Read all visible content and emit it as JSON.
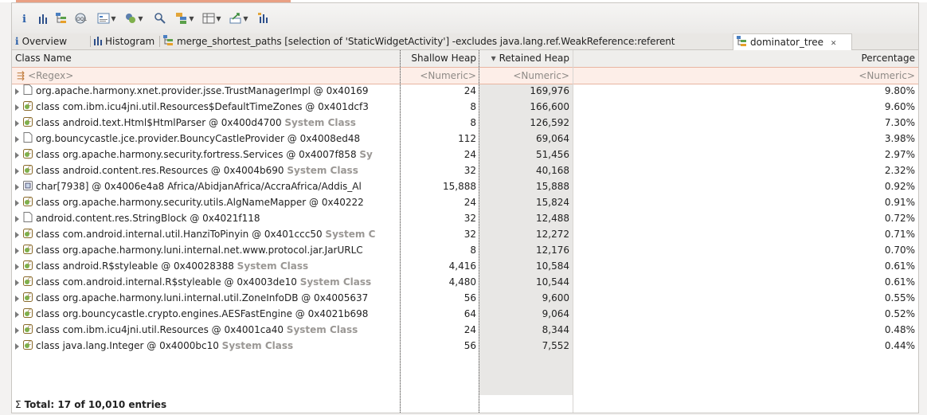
{
  "tabs": [
    {
      "icon": "info-icon",
      "label": "Overview",
      "active": false
    },
    {
      "icon": "histogram-icon",
      "label": "Histogram",
      "active": false
    },
    {
      "icon": "tree-icon",
      "label": "merge_shortest_paths [selection of 'StaticWidgetActivity'] -excludes java.lang.ref.WeakReference:referent",
      "active": false
    },
    {
      "icon": "tree-icon",
      "label": "dominator_tree",
      "active": true,
      "close": "✕"
    }
  ],
  "toolbar": {
    "buttons": [
      "info-icon",
      "histogram-icon",
      "dominator-tree-icon",
      "top-consumers-icon",
      "query-browser-icon",
      "group-icon",
      "search-icon",
      "grouping-icon",
      "calculate-retained-icon",
      "export-icon",
      "overview-icon"
    ]
  },
  "columns": {
    "class_name": "Class Name",
    "shallow_heap": "Shallow Heap",
    "retained_heap": "Retained Heap",
    "retained_sort": "▾",
    "percentage": "Percentage"
  },
  "filter": {
    "class_name": "<Regex>",
    "shallow_heap": "<Numeric>",
    "retained_heap": "<Numeric>",
    "percentage": "<Numeric>"
  },
  "rows": [
    {
      "icon": "instance-icon",
      "name": "org.apache.harmony.xnet.provider.jsse.TrustManagerImpl @ 0x40169",
      "sys": "",
      "shallow": "24",
      "retained": "169,976",
      "pct": "9.80%"
    },
    {
      "icon": "class-icon",
      "name": "class com.ibm.icu4jni.util.Resources$DefaultTimeZones @ 0x401dcf3",
      "sys": "",
      "shallow": "8",
      "retained": "166,600",
      "pct": "9.60%"
    },
    {
      "icon": "class-icon",
      "name": "class android.text.Html$HtmlParser @ 0x400d4700",
      "sys": "System Class",
      "shallow": "8",
      "retained": "126,592",
      "pct": "7.30%"
    },
    {
      "icon": "instance-icon",
      "name": "org.bouncycastle.jce.provider.BouncyCastleProvider @ 0x4008ed48",
      "sys": "",
      "shallow": "112",
      "retained": "69,064",
      "pct": "3.98%"
    },
    {
      "icon": "class-icon",
      "name": "class org.apache.harmony.security.fortress.Services @ 0x4007f858",
      "sys": "Sy",
      "shallow": "24",
      "retained": "51,456",
      "pct": "2.97%"
    },
    {
      "icon": "class-icon",
      "name": "class android.content.res.Resources @ 0x4004b690",
      "sys": "System Class",
      "shallow": "32",
      "retained": "40,168",
      "pct": "2.32%"
    },
    {
      "icon": "array-icon",
      "name": "char[7938] @ 0x4006e4a8  Africa/AbidjanAfrica/AccraAfrica/Addis_Al",
      "sys": "",
      "shallow": "15,888",
      "retained": "15,888",
      "pct": "0.92%"
    },
    {
      "icon": "class-icon",
      "name": "class org.apache.harmony.security.utils.AlgNameMapper @ 0x40222",
      "sys": "",
      "shallow": "24",
      "retained": "15,824",
      "pct": "0.91%"
    },
    {
      "icon": "instance-icon",
      "name": "android.content.res.StringBlock @ 0x4021f118",
      "sys": "",
      "shallow": "32",
      "retained": "12,488",
      "pct": "0.72%"
    },
    {
      "icon": "class-icon",
      "name": "class com.android.internal.util.HanziToPinyin @ 0x401ccc50",
      "sys": "System C",
      "shallow": "32",
      "retained": "12,272",
      "pct": "0.71%"
    },
    {
      "icon": "class-icon",
      "name": "class org.apache.harmony.luni.internal.net.www.protocol.jar.JarURLC",
      "sys": "",
      "shallow": "8",
      "retained": "12,176",
      "pct": "0.70%"
    },
    {
      "icon": "class-icon",
      "name": "class android.R$styleable @ 0x40028388",
      "sys": "System Class",
      "shallow": "4,416",
      "retained": "10,584",
      "pct": "0.61%"
    },
    {
      "icon": "class-icon",
      "name": "class com.android.internal.R$styleable @ 0x4003de10",
      "sys": "System Class",
      "shallow": "4,480",
      "retained": "10,544",
      "pct": "0.61%"
    },
    {
      "icon": "class-icon",
      "name": "class org.apache.harmony.luni.internal.util.ZoneInfoDB @ 0x4005637",
      "sys": "",
      "shallow": "56",
      "retained": "9,600",
      "pct": "0.55%"
    },
    {
      "icon": "class-icon",
      "name": "class org.bouncycastle.crypto.engines.AESFastEngine @ 0x4021b698",
      "sys": "",
      "shallow": "64",
      "retained": "9,064",
      "pct": "0.52%"
    },
    {
      "icon": "class-icon",
      "name": "class com.ibm.icu4jni.util.Resources @ 0x4001ca40",
      "sys": "System Class",
      "shallow": "24",
      "retained": "8,344",
      "pct": "0.48%"
    },
    {
      "icon": "class-icon",
      "name": "class java.lang.Integer @ 0x4000bc10",
      "sys": "System Class",
      "shallow": "56",
      "retained": "7,552",
      "pct": "0.44%"
    }
  ],
  "total": {
    "icon": "sum-icon",
    "label": "Total: 17 of 10,010 entries"
  },
  "colors": {
    "filter_bg": "#fdeee8",
    "accent": "#e9a084",
    "system_class": "#9a9794"
  }
}
